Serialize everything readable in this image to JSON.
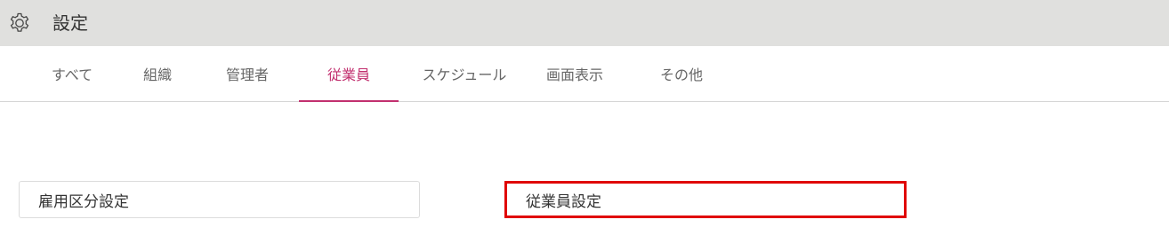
{
  "header": {
    "icon": "gear-icon",
    "title": "設定",
    "background": "#e0e0de"
  },
  "tabs": [
    {
      "label": "すべて",
      "active": false
    },
    {
      "label": "組織",
      "active": false
    },
    {
      "label": "管理者",
      "active": false
    },
    {
      "label": "従業員",
      "active": true
    },
    {
      "label": "スケジュール",
      "active": false
    },
    {
      "label": "画面表示",
      "active": false
    },
    {
      "label": "その他",
      "active": false
    }
  ],
  "accent_color": "#c2306f",
  "highlight_color": "#e00000",
  "cards": [
    {
      "label": "雇用区分設定",
      "highlighted": false
    },
    {
      "label": "従業員設定",
      "highlighted": true
    }
  ]
}
